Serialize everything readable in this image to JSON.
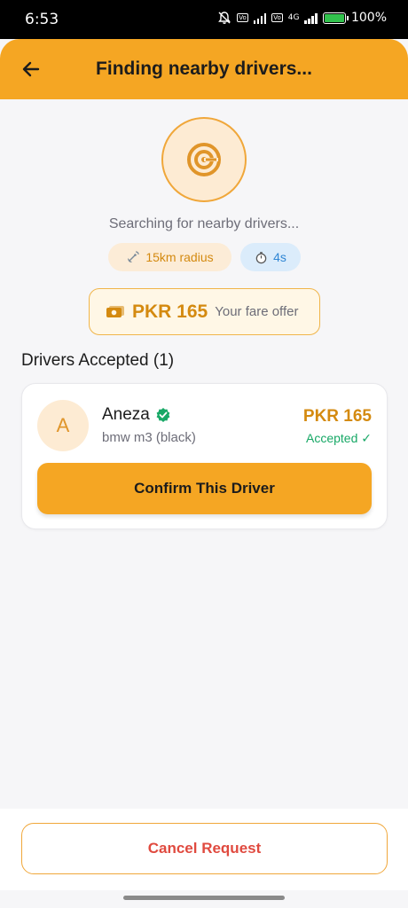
{
  "status_bar": {
    "time": "6:53",
    "network": "4G",
    "battery": "100%"
  },
  "header": {
    "title": "Finding nearby drivers..."
  },
  "search": {
    "status_text": "Searching for nearby drivers...",
    "radius_chip": "15km radius",
    "timer_chip": "4s"
  },
  "fare": {
    "amount": "PKR 165",
    "label": "Your fare offer"
  },
  "drivers": {
    "section_title": "Drivers Accepted (1)",
    "items": [
      {
        "initial": "A",
        "name": "Aneza",
        "vehicle": "bmw m3 (black)",
        "price": "PKR 165",
        "status": "Accepted ✓",
        "confirm_label": "Confirm This Driver"
      }
    ]
  },
  "footer": {
    "cancel_label": "Cancel Request"
  },
  "colors": {
    "accent": "#f5a623",
    "accent_text": "#d48a10",
    "accepted": "#17a866",
    "cancel": "#e04a3f",
    "timer": "#2f86d4"
  }
}
